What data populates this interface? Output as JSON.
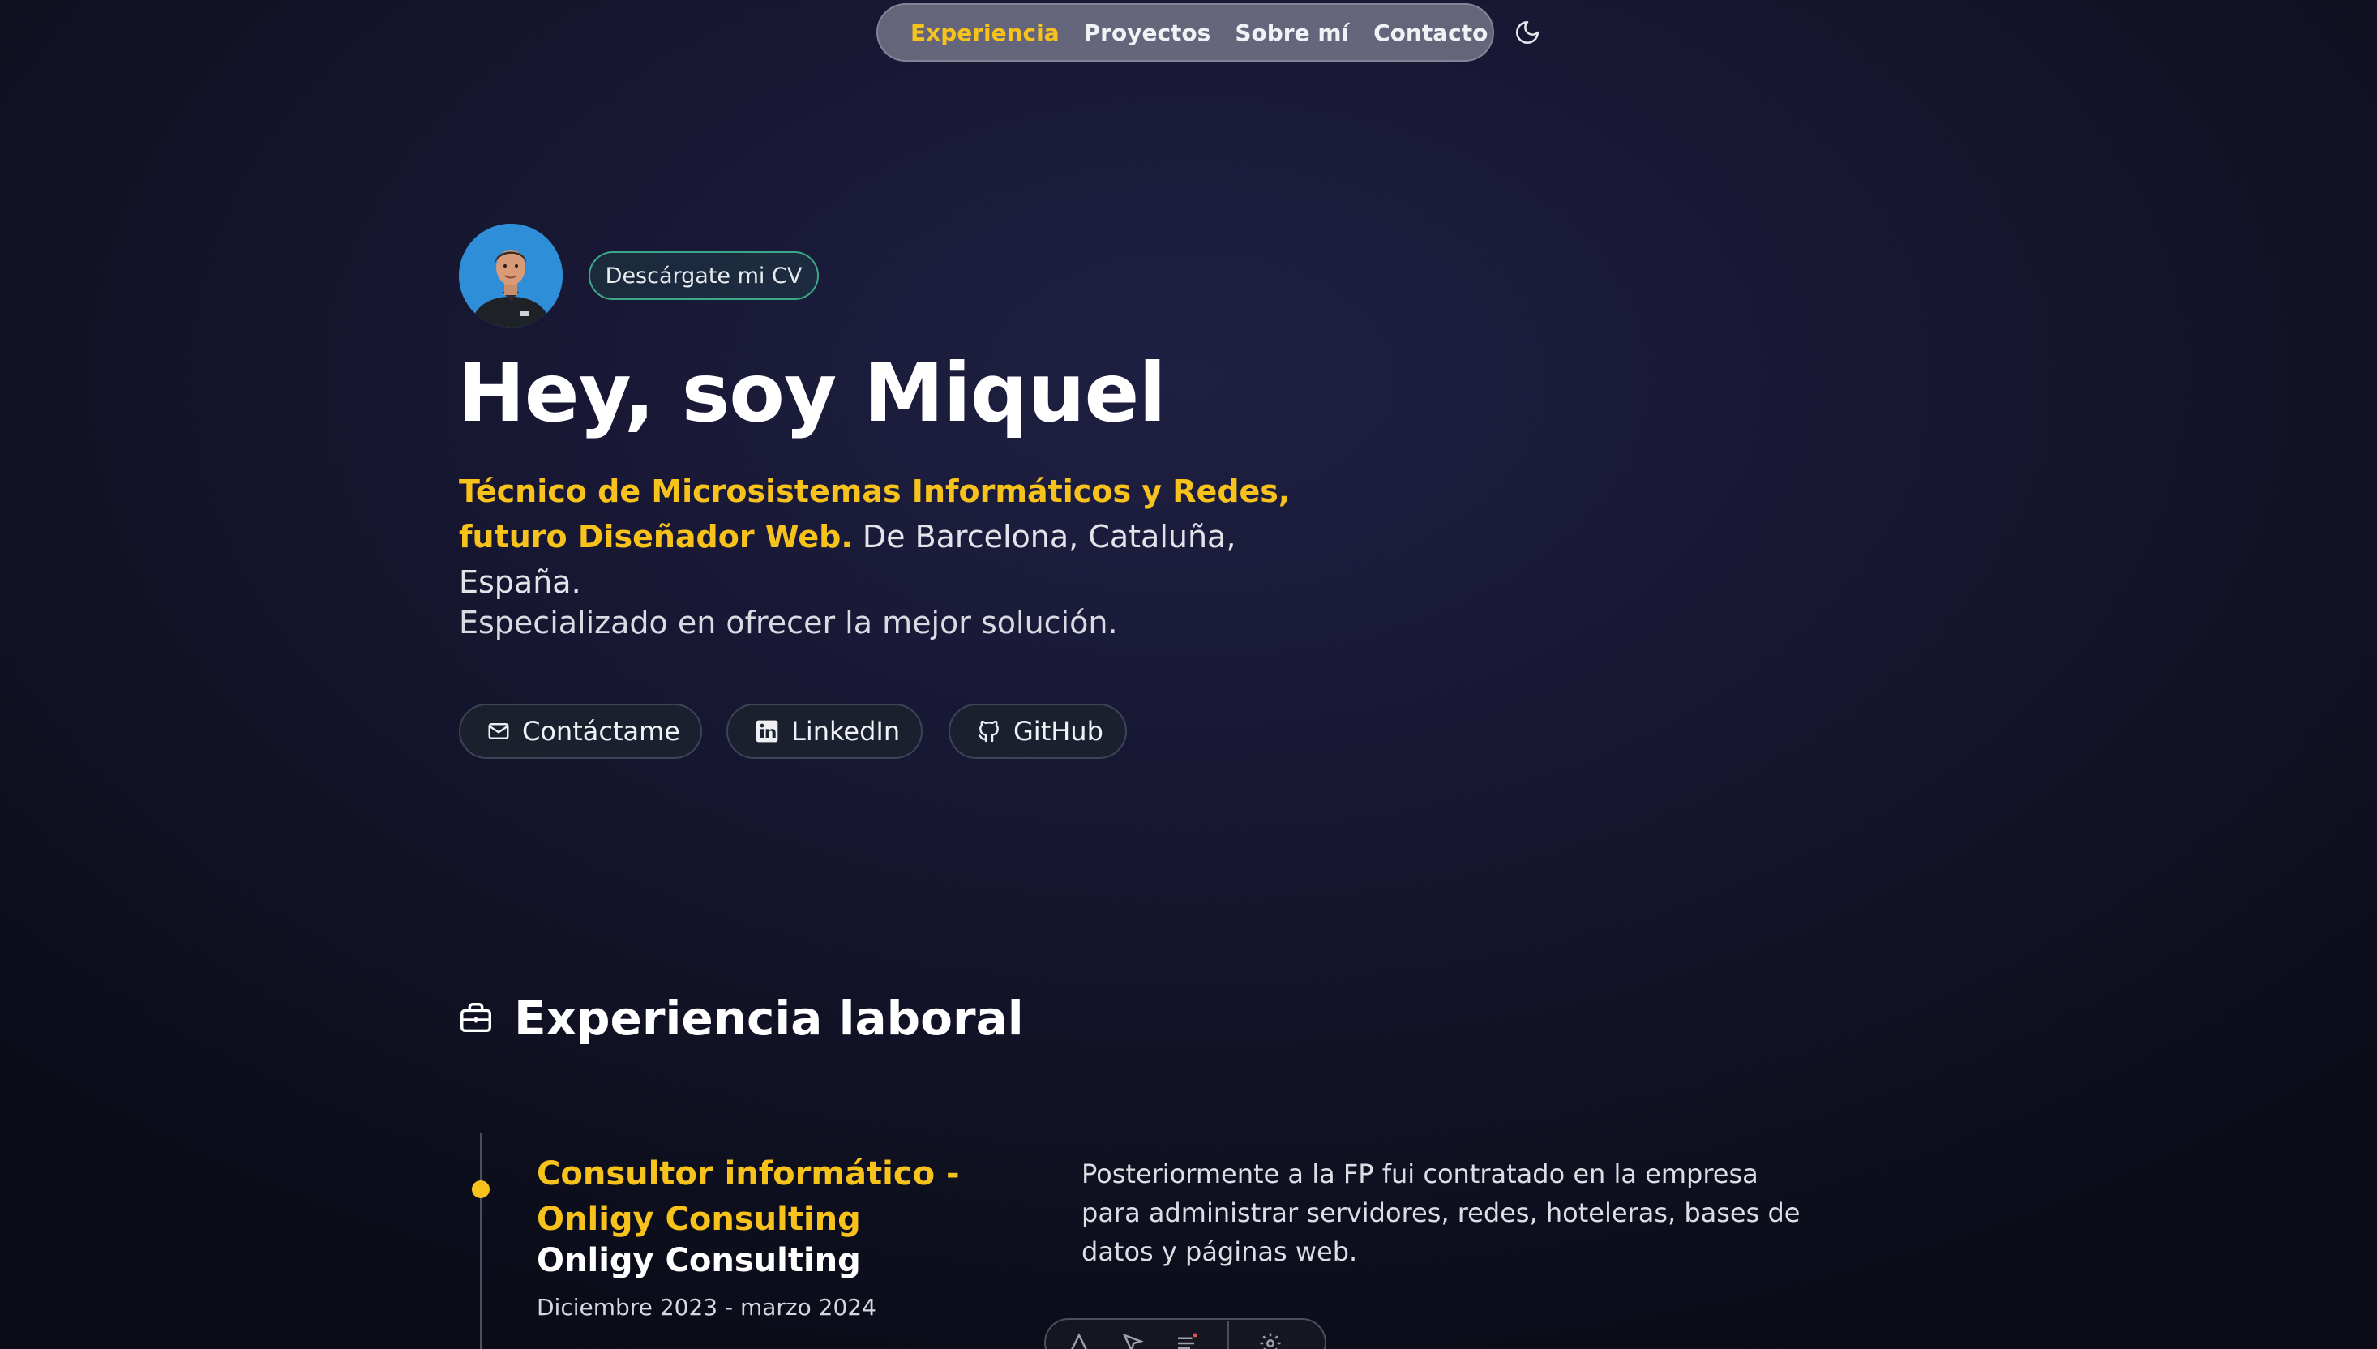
{
  "nav": {
    "items": [
      {
        "label": "Experiencia",
        "active": true
      },
      {
        "label": "Proyectos",
        "active": false
      },
      {
        "label": "Sobre mí",
        "active": false
      },
      {
        "label": "Contacto",
        "active": false
      }
    ],
    "theme_icon": "moon-icon"
  },
  "hero": {
    "cv_button": "Descárgate mi CV",
    "title": "Hey, soy Miquel",
    "highlight": "Técnico de Microsistemas Informáticos y Redes, futuro Diseñador Web.",
    "location": " De Barcelona, Cataluña, España.",
    "specialty": "Especializado en ofrecer la mejor solución.",
    "social": [
      {
        "label": "Contáctame",
        "icon": "mail-icon"
      },
      {
        "label": "LinkedIn",
        "icon": "linkedin-icon"
      },
      {
        "label": "GitHub",
        "icon": "github-icon"
      }
    ]
  },
  "experience": {
    "title": "Experiencia laboral",
    "icon": "briefcase-icon",
    "jobs": [
      {
        "title": "Consultor informático - Onligy Consulting",
        "company": "Onligy Consulting",
        "date": "Diciembre 2023 - marzo 2024",
        "description": "Posteriormente a la FP fui contratado en la empresa para administrar servidores, redes, hoteleras, bases de datos y páginas web."
      }
    ]
  },
  "colors": {
    "accent": "#f7c21b",
    "background": "#181835",
    "cv_border": "#3ba88a",
    "avatar_bg": "#2e8fd8"
  }
}
